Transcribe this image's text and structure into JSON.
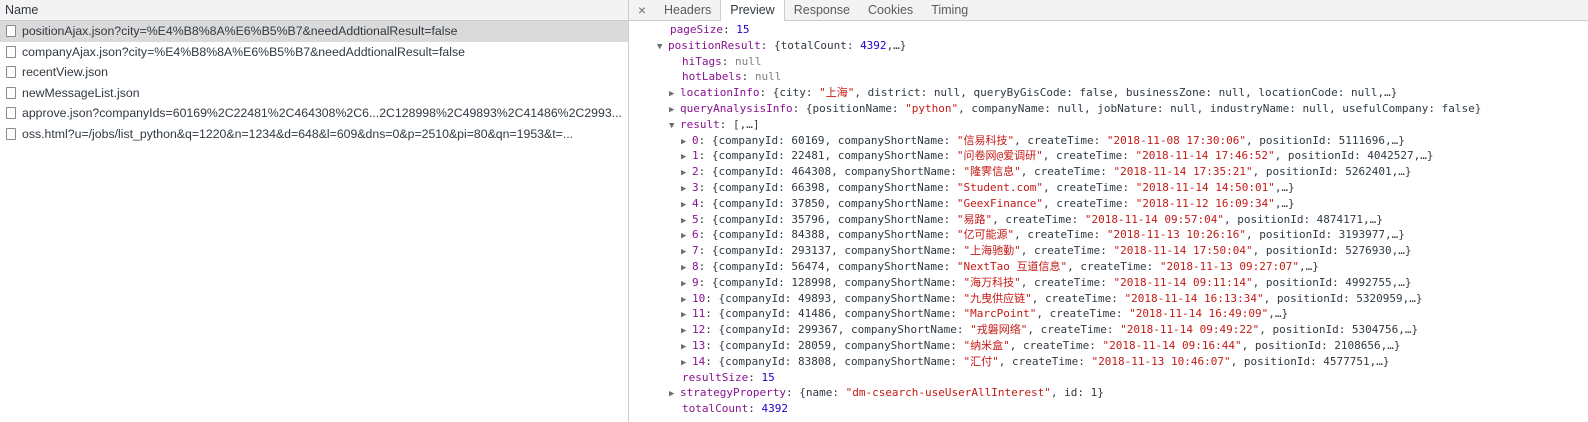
{
  "left": {
    "header": "Name",
    "requests": [
      {
        "name": "positionAjax.json?city=%E4%B8%8A%E6%B5%B7&needAddtionalResult=false",
        "selected": true
      },
      {
        "name": "companyAjax.json?city=%E4%B8%8A%E6%B5%B7&needAddtionalResult=false",
        "selected": false
      },
      {
        "name": "recentView.json",
        "selected": false
      },
      {
        "name": "newMessageList.json",
        "selected": false
      },
      {
        "name": "approve.json?companyIds=60169%2C22481%2C464308%2C6...2C128998%2C49893%2C41486%2C2993...",
        "selected": false
      },
      {
        "name": "oss.html?u=/jobs/list_python&q=1220&n=1234&d=648&l=609&dns=0&p=2510&pi=80&qn=1953&t=...",
        "selected": false
      }
    ]
  },
  "right": {
    "close": "×",
    "tabs": [
      "Headers",
      "Preview",
      "Response",
      "Cookies",
      "Timing"
    ],
    "active_tab": "Preview",
    "colors": {
      "key": "#881391",
      "number": "#1c00cf",
      "string": "#c41a16",
      "null": "#808080"
    },
    "tree": [
      {
        "indent": 0,
        "arrow": "",
        "key": "pageSize",
        "parts": [
          {
            "t": "num",
            "v": "15"
          }
        ]
      },
      {
        "indent": 0,
        "arrow": "down",
        "key": "positionResult",
        "parts": [
          {
            "t": "txt",
            "v": "{totalCount: "
          },
          {
            "t": "num",
            "v": "4392"
          },
          {
            "t": "txt",
            "v": ",…}"
          }
        ]
      },
      {
        "indent": 1,
        "arrow": "",
        "key": "hiTags",
        "parts": [
          {
            "t": "nul",
            "v": "null"
          }
        ]
      },
      {
        "indent": 1,
        "arrow": "",
        "key": "hotLabels",
        "parts": [
          {
            "t": "nul",
            "v": "null"
          }
        ]
      },
      {
        "indent": 1,
        "arrow": "right",
        "key": "locationInfo",
        "parts": [
          {
            "t": "txt",
            "v": "{city: "
          },
          {
            "t": "str",
            "v": "\"上海\""
          },
          {
            "t": "txt",
            "v": ", district: null, queryByGisCode: false, businessZone: null, locationCode: null,…}"
          }
        ]
      },
      {
        "indent": 1,
        "arrow": "right",
        "key": "queryAnalysisInfo",
        "parts": [
          {
            "t": "txt",
            "v": "{positionName: "
          },
          {
            "t": "str",
            "v": "\"python\""
          },
          {
            "t": "txt",
            "v": ", companyName: null, jobNature: null, industryName: null, usefulCompany: false}"
          }
        ]
      },
      {
        "indent": 1,
        "arrow": "down",
        "key": "result",
        "parts": [
          {
            "t": "txt",
            "v": "[,…]"
          }
        ]
      },
      {
        "indent": 2,
        "arrow": "right",
        "key": "0",
        "parts": [
          {
            "t": "txt",
            "v": "{companyId: 60169, companyShortName: "
          },
          {
            "t": "str",
            "v": "\"信易科技\""
          },
          {
            "t": "txt",
            "v": ", createTime: "
          },
          {
            "t": "str",
            "v": "\"2018-11-08 17:30:06\""
          },
          {
            "t": "txt",
            "v": ", positionId: 5111696,…}"
          }
        ]
      },
      {
        "indent": 2,
        "arrow": "right",
        "key": "1",
        "parts": [
          {
            "t": "txt",
            "v": "{companyId: 22481, companyShortName: "
          },
          {
            "t": "str",
            "v": "\"问卷网@爱调研\""
          },
          {
            "t": "txt",
            "v": ", createTime: "
          },
          {
            "t": "str",
            "v": "\"2018-11-14 17:46:52\""
          },
          {
            "t": "txt",
            "v": ", positionId: 4042527,…}"
          }
        ]
      },
      {
        "indent": 2,
        "arrow": "right",
        "key": "2",
        "parts": [
          {
            "t": "txt",
            "v": "{companyId: 464308, companyShortName: "
          },
          {
            "t": "str",
            "v": "\"隆霁信息\""
          },
          {
            "t": "txt",
            "v": ", createTime: "
          },
          {
            "t": "str",
            "v": "\"2018-11-14 17:35:21\""
          },
          {
            "t": "txt",
            "v": ", positionId: 5262401,…}"
          }
        ]
      },
      {
        "indent": 2,
        "arrow": "right",
        "key": "3",
        "parts": [
          {
            "t": "txt",
            "v": "{companyId: 66398, companyShortName: "
          },
          {
            "t": "str",
            "v": "\"Student.com\""
          },
          {
            "t": "txt",
            "v": ", createTime: "
          },
          {
            "t": "str",
            "v": "\"2018-11-14 14:50:01\""
          },
          {
            "t": "txt",
            "v": ",…}"
          }
        ]
      },
      {
        "indent": 2,
        "arrow": "right",
        "key": "4",
        "parts": [
          {
            "t": "txt",
            "v": "{companyId: 37850, companyShortName: "
          },
          {
            "t": "str",
            "v": "\"GeexFinance\""
          },
          {
            "t": "txt",
            "v": ", createTime: "
          },
          {
            "t": "str",
            "v": "\"2018-11-12 16:09:34\""
          },
          {
            "t": "txt",
            "v": ",…}"
          }
        ]
      },
      {
        "indent": 2,
        "arrow": "right",
        "key": "5",
        "parts": [
          {
            "t": "txt",
            "v": "{companyId: 35796, companyShortName: "
          },
          {
            "t": "str",
            "v": "\"易路\""
          },
          {
            "t": "txt",
            "v": ", createTime: "
          },
          {
            "t": "str",
            "v": "\"2018-11-14 09:57:04\""
          },
          {
            "t": "txt",
            "v": ", positionId: 4874171,…}"
          }
        ]
      },
      {
        "indent": 2,
        "arrow": "right",
        "key": "6",
        "parts": [
          {
            "t": "txt",
            "v": "{companyId: 84388, companyShortName: "
          },
          {
            "t": "str",
            "v": "\"亿可能源\""
          },
          {
            "t": "txt",
            "v": ", createTime: "
          },
          {
            "t": "str",
            "v": "\"2018-11-13 10:26:16\""
          },
          {
            "t": "txt",
            "v": ", positionId: 3193977,…}"
          }
        ]
      },
      {
        "indent": 2,
        "arrow": "right",
        "key": "7",
        "parts": [
          {
            "t": "txt",
            "v": "{companyId: 293137, companyShortName: "
          },
          {
            "t": "str",
            "v": "\"上海驰勤\""
          },
          {
            "t": "txt",
            "v": ", createTime: "
          },
          {
            "t": "str",
            "v": "\"2018-11-14 17:50:04\""
          },
          {
            "t": "txt",
            "v": ", positionId: 5276930,…}"
          }
        ]
      },
      {
        "indent": 2,
        "arrow": "right",
        "key": "8",
        "parts": [
          {
            "t": "txt",
            "v": "{companyId: 56474, companyShortName: "
          },
          {
            "t": "str",
            "v": "\"NextTao 互道信息\""
          },
          {
            "t": "txt",
            "v": ", createTime: "
          },
          {
            "t": "str",
            "v": "\"2018-11-13 09:27:07\""
          },
          {
            "t": "txt",
            "v": ",…}"
          }
        ]
      },
      {
        "indent": 2,
        "arrow": "right",
        "key": "9",
        "parts": [
          {
            "t": "txt",
            "v": "{companyId: 128998, companyShortName: "
          },
          {
            "t": "str",
            "v": "\"海万科技\""
          },
          {
            "t": "txt",
            "v": ", createTime: "
          },
          {
            "t": "str",
            "v": "\"2018-11-14 09:11:14\""
          },
          {
            "t": "txt",
            "v": ", positionId: 4992755,…}"
          }
        ]
      },
      {
        "indent": 2,
        "arrow": "right",
        "key": "10",
        "parts": [
          {
            "t": "txt",
            "v": "{companyId: 49893, companyShortName: "
          },
          {
            "t": "str",
            "v": "\"九曳供应链\""
          },
          {
            "t": "txt",
            "v": ", createTime: "
          },
          {
            "t": "str",
            "v": "\"2018-11-14 16:13:34\""
          },
          {
            "t": "txt",
            "v": ", positionId: 5320959,…}"
          }
        ]
      },
      {
        "indent": 2,
        "arrow": "right",
        "key": "11",
        "parts": [
          {
            "t": "txt",
            "v": "{companyId: 41486, companyShortName: "
          },
          {
            "t": "str",
            "v": "\"MarcPoint\""
          },
          {
            "t": "txt",
            "v": ", createTime: "
          },
          {
            "t": "str",
            "v": "\"2018-11-14 16:49:09\""
          },
          {
            "t": "txt",
            "v": ",…}"
          }
        ]
      },
      {
        "indent": 2,
        "arrow": "right",
        "key": "12",
        "parts": [
          {
            "t": "txt",
            "v": "{companyId: 299367, companyShortName: "
          },
          {
            "t": "str",
            "v": "\"戎磐网络\""
          },
          {
            "t": "txt",
            "v": ", createTime: "
          },
          {
            "t": "str",
            "v": "\"2018-11-14 09:49:22\""
          },
          {
            "t": "txt",
            "v": ", positionId: 5304756,…}"
          }
        ]
      },
      {
        "indent": 2,
        "arrow": "right",
        "key": "13",
        "parts": [
          {
            "t": "txt",
            "v": "{companyId: 28059, companyShortName: "
          },
          {
            "t": "str",
            "v": "\"纳米盒\""
          },
          {
            "t": "txt",
            "v": ", createTime: "
          },
          {
            "t": "str",
            "v": "\"2018-11-14 09:16:44\""
          },
          {
            "t": "txt",
            "v": ", positionId: 2108656,…}"
          }
        ]
      },
      {
        "indent": 2,
        "arrow": "right",
        "key": "14",
        "parts": [
          {
            "t": "txt",
            "v": "{companyId: 83808, companyShortName: "
          },
          {
            "t": "str",
            "v": "\"汇付\""
          },
          {
            "t": "txt",
            "v": ", createTime: "
          },
          {
            "t": "str",
            "v": "\"2018-11-13 10:46:07\""
          },
          {
            "t": "txt",
            "v": ", positionId: 4577751,…}"
          }
        ]
      },
      {
        "indent": 1,
        "arrow": "",
        "key": "resultSize",
        "parts": [
          {
            "t": "num",
            "v": "15"
          }
        ]
      },
      {
        "indent": 1,
        "arrow": "right",
        "key": "strategyProperty",
        "parts": [
          {
            "t": "txt",
            "v": "{name: "
          },
          {
            "t": "str",
            "v": "\"dm-csearch-useUserAllInterest\""
          },
          {
            "t": "txt",
            "v": ", id: 1}"
          }
        ]
      },
      {
        "indent": 1,
        "arrow": "",
        "key": "totalCount",
        "parts": [
          {
            "t": "num",
            "v": "4392"
          }
        ]
      }
    ]
  }
}
